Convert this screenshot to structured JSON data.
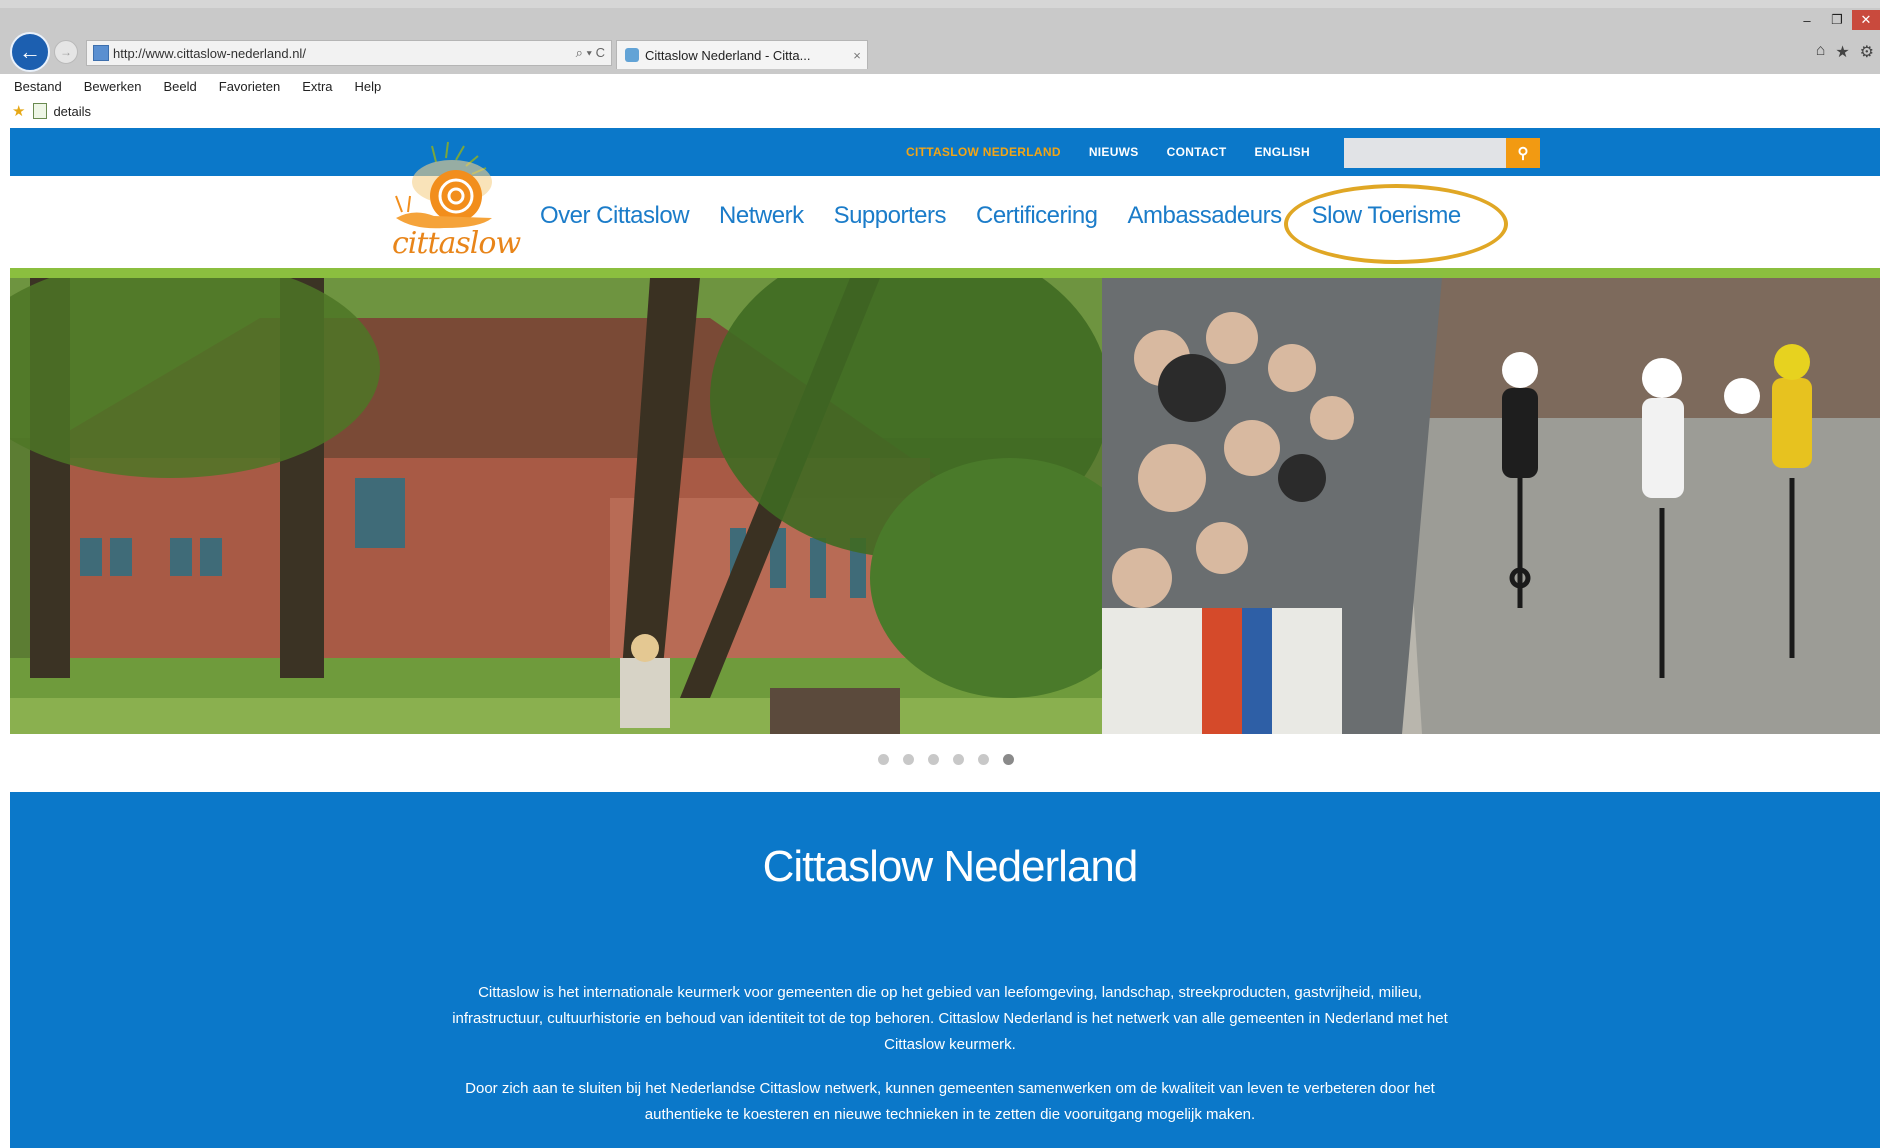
{
  "browser": {
    "url": "http://www.cittaslow-nederland.nl/",
    "tab_title": "Cittaslow Nederland - Citta...",
    "tab_close": "×",
    "address_tools": "⌕ ▾ C",
    "window_controls": [
      "–",
      "❐",
      "✕"
    ],
    "menu": [
      "Bestand",
      "Bewerken",
      "Beeld",
      "Favorieten",
      "Extra",
      "Help"
    ],
    "favorites_bar_item": "details"
  },
  "site": {
    "top_links": [
      "CITTASLOW NEDERLAND",
      "NIEUWS",
      "CONTACT",
      "ENGLISH"
    ],
    "search_button_icon": "search-icon",
    "logo_text": "cittaslow",
    "nav": [
      "Over Cittaslow",
      "Netwerk",
      "Supporters",
      "Certificering",
      "Ambassadeurs",
      "Slow Toerisme"
    ],
    "highlighted_nav_item": "Slow Toerisme",
    "carousel": {
      "slides": 6,
      "active": 6
    },
    "section_title": "Cittaslow Nederland",
    "intro_paragraphs": [
      "Cittaslow is het internationale keurmerk voor gemeenten die op het gebied van leefomgeving, landschap, streekproducten, gastvrijheid, milieu, infrastructuur, cultuurhistorie en behoud van identiteit tot de top behoren. Cittaslow Nederland is het netwerk van alle gemeenten in Nederland met het Cittaslow keurmerk.",
      "Door zich aan te sluiten bij het Nederlandse Cittaslow netwerk, kunnen gemeenten samenwerken om de kwaliteit van leven te verbeteren door het authentieke te koesteren en nieuwe technieken in te zetten die vooruitgang mogelijk maken."
    ],
    "colors": {
      "primary_blue": "#0b78c9",
      "accent_orange": "#f29a12",
      "accent_green": "#8bbf3f",
      "highlight_ring": "#e0a725"
    }
  }
}
